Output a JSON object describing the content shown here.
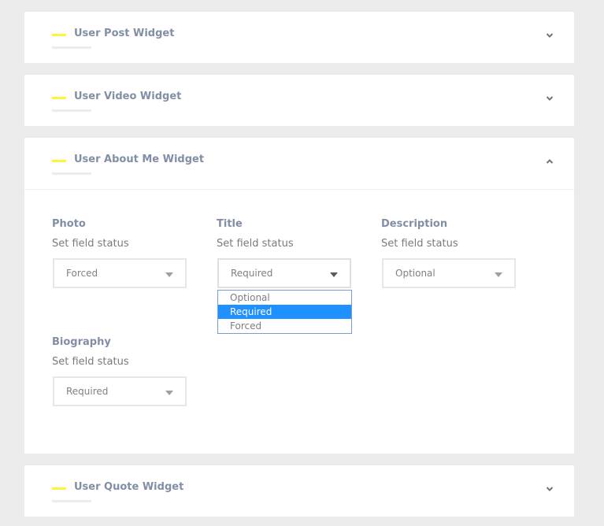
{
  "panels": [
    {
      "title": "User Post Widget",
      "expanded": false
    },
    {
      "title": "User Video Widget",
      "expanded": false
    },
    {
      "title": "User About Me Widget",
      "expanded": true
    },
    {
      "title": "User Quote Widget",
      "expanded": false
    }
  ],
  "fields": {
    "photo": {
      "label": "Photo",
      "subtitle": "Set field status",
      "value": "Forced"
    },
    "title": {
      "label": "Title",
      "subtitle": "Set field status",
      "value": "Required"
    },
    "description": {
      "label": "Description",
      "subtitle": "Set field status",
      "value": "Optional"
    },
    "biography": {
      "label": "Biography",
      "subtitle": "Set field status",
      "value": "Required"
    }
  },
  "dropdown": {
    "options": [
      "Optional",
      "Required",
      "Forced"
    ],
    "selected": "Required"
  },
  "colors": {
    "accent_dash": "#fff33b",
    "label": "#818ea5",
    "dropdown_highlight": "#1e90ff"
  },
  "icons": {
    "collapsed": "chevron-down-icon",
    "expanded": "chevron-up-icon",
    "select": "caret-down-icon"
  }
}
